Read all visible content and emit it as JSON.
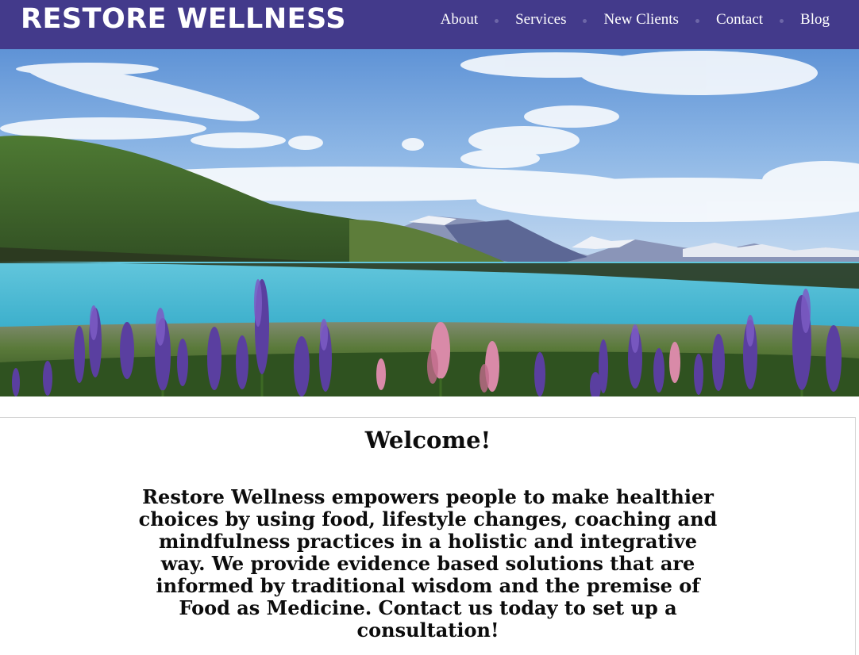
{
  "header": {
    "logo": "RESTORE WELLNESS",
    "background_color": "#433a8b",
    "nav": [
      {
        "label": "About"
      },
      {
        "label": "Services"
      },
      {
        "label": "New Clients"
      },
      {
        "label": "Contact"
      },
      {
        "label": "Blog"
      }
    ]
  },
  "hero": {
    "image": "landscape-photo-lake-mountains-lupines"
  },
  "main": {
    "heading": "Welcome!",
    "intro": "Restore Wellness empowers people to make healthier choices by using food, lifestyle changes, coaching and mindfulness practices in a holistic and integrative way. We provide evidence based solutions that are informed by traditional wisdom and the premise of Food as Medicine. Contact us today to set up a consultation!"
  }
}
